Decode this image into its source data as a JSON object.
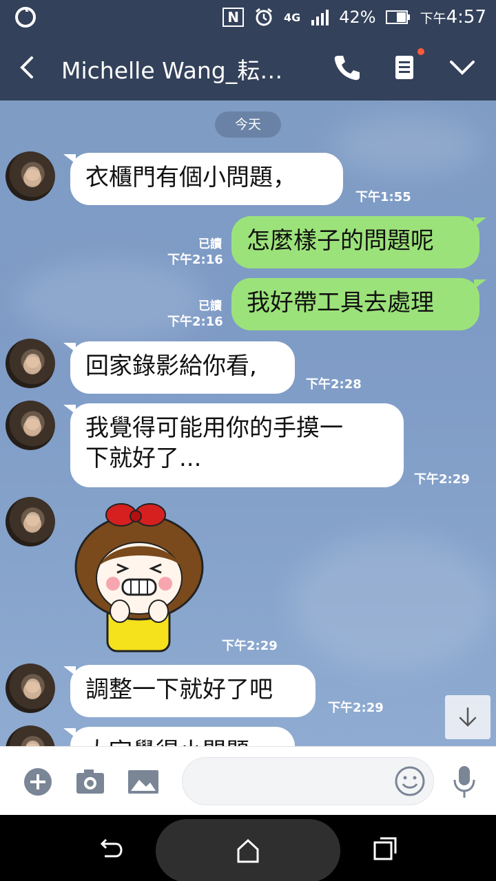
{
  "status_bar": {
    "nfc": "N",
    "network": "4G",
    "battery": "42%",
    "time_prefix": "下午",
    "time": "4:57"
  },
  "header": {
    "title": "Michelle Wang_耘安…"
  },
  "chat": {
    "date_chip": "今天",
    "messages": [
      {
        "text": "衣櫃門有個小問題，",
        "time": "下午1:55"
      },
      {
        "text": "怎麼樣子的問題呢",
        "read": "已讀",
        "time": "下午2:16"
      },
      {
        "text": "我好帶工具去處理",
        "read": "已讀",
        "time": "下午2:16"
      },
      {
        "text": "回家錄影給你看,",
        "time": "下午2:28"
      },
      {
        "text_line1": "我覺得可能用你的手摸一",
        "text_line2": "下就好了...",
        "time": "下午2:29"
      },
      {
        "sticker": "girl-sticker",
        "time": "下午2:29"
      },
      {
        "text": "調整一下就好了吧",
        "time": "下午2:29"
      },
      {
        "text": "大宇覺得小問題"
      }
    ]
  },
  "colors": {
    "header_bg": "#33415a",
    "outgoing_bubble": "#9ce27a",
    "incoming_bubble": "#ffffff",
    "chat_bg": "#7f9cc4"
  }
}
